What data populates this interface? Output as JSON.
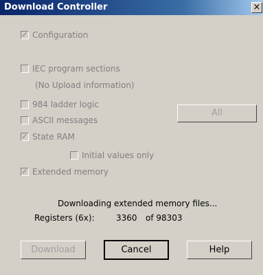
{
  "window": {
    "title": "Download Controller",
    "close_glyph": "×"
  },
  "options": {
    "configuration": {
      "label": "Configuration",
      "checked": true
    },
    "iec_sections": {
      "label": "IEC program sections",
      "checked": false
    },
    "no_upload_note": "(No Upload information)",
    "ladder_logic": {
      "label": "984 ladder logic",
      "checked": false
    },
    "ascii": {
      "label": "ASCII messages",
      "checked": false
    },
    "state_ram": {
      "label": "State RAM",
      "checked": true
    },
    "initial_values": {
      "label": "Initial values only",
      "checked": false
    },
    "extended_memory": {
      "label": "Extended memory",
      "checked": true
    }
  },
  "buttons": {
    "all": "All",
    "download": "Download",
    "cancel": "Cancel",
    "help": "Help"
  },
  "status": {
    "message": "Downloading extended memory files...",
    "registers_label": "Registers (6x):",
    "registers_current": "3360",
    "registers_total": "of 98303"
  },
  "icons": {
    "check": "check-icon"
  }
}
